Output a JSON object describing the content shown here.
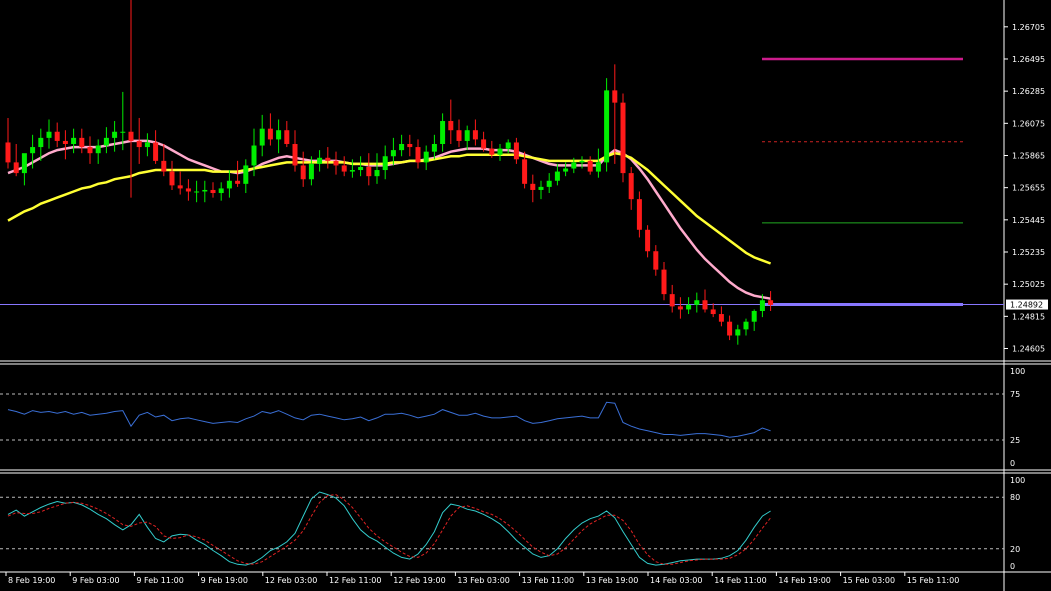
{
  "chart_data": [
    {
      "type": "candlestick",
      "panel": "price",
      "x_labels": [
        "8 Feb 19:00",
        "9 Feb 03:00",
        "9 Feb 11:00",
        "9 Feb 19:00",
        "12 Feb 03:00",
        "12 Feb 11:00",
        "12 Feb 19:00",
        "13 Feb 03:00",
        "13 Feb 11:00",
        "13 Feb 19:00",
        "14 Feb 03:00",
        "14 Feb 11:00",
        "14 Feb 19:00",
        "15 Feb 03:00",
        "15 Feb 11:00"
      ],
      "y_ticks": [
        "1.26705",
        "1.26495",
        "1.26285",
        "1.26075",
        "1.25865",
        "1.25655",
        "1.25445",
        "1.25235",
        "1.25025",
        "1.24815",
        "1.24605"
      ],
      "ylim": [
        1.2453,
        1.2688
      ],
      "current_price_label": "1.24892",
      "current_price": 1.24892,
      "levels": [
        {
          "name": "magenta-level",
          "price": 1.26495,
          "color": "#cc1c8c",
          "style": "solid"
        },
        {
          "name": "red-dashed-level",
          "price": 1.25955,
          "color": "#cc2222",
          "style": "dashed"
        },
        {
          "name": "green-level",
          "price": 1.25425,
          "color": "#22aa22",
          "style": "solid"
        },
        {
          "name": "blue-level",
          "price": 1.24892,
          "color": "#8877ff",
          "style": "solid"
        }
      ],
      "candles": {
        "open": [
          1.2595,
          1.2582,
          1.2575,
          1.2588,
          1.2592,
          1.2598,
          1.2602,
          1.2596,
          1.2594,
          1.2598,
          1.2592,
          1.2588,
          1.2593,
          1.2598,
          1.2602,
          1.2602,
          1.2596,
          1.2592,
          1.2595,
          1.2583,
          1.2576,
          1.2567,
          1.2565,
          1.2563,
          1.2563,
          1.2564,
          1.2562,
          1.2565,
          1.257,
          1.2568,
          1.258,
          1.2593,
          1.2604,
          1.2597,
          1.2603,
          1.2594,
          1.258,
          1.2571,
          1.2581,
          1.2585,
          1.2583,
          1.258,
          1.2576,
          1.2577,
          1.2579,
          1.2573,
          1.2577,
          1.2586,
          1.259,
          1.2594,
          1.2592,
          1.2582,
          1.2589,
          1.2594,
          1.2609,
          1.2603,
          1.2596,
          1.2603,
          1.2597,
          1.2591,
          1.2587,
          1.2591,
          1.2595,
          1.2584,
          1.2568,
          1.2564,
          1.2566,
          1.257,
          1.2576,
          1.2578,
          1.2582,
          1.2583,
          1.2576,
          1.2582,
          1.2629,
          1.2621,
          1.2575,
          1.2558,
          1.2538,
          1.2524,
          1.2512,
          1.2496,
          1.2488,
          1.2486,
          1.2489,
          1.2492,
          1.2486,
          1.2483,
          1.2478,
          1.2469,
          1.2473,
          1.2478,
          1.2485,
          1.2492
        ],
        "high": [
          1.2611,
          1.2594,
          1.258,
          1.26,
          1.2604,
          1.261,
          1.2608,
          1.2603,
          1.2604,
          1.2604,
          1.2599,
          1.2597,
          1.2605,
          1.2609,
          1.2628,
          1.2688,
          1.2611,
          1.2601,
          1.2603,
          1.2594,
          1.2583,
          1.2576,
          1.2571,
          1.257,
          1.257,
          1.2569,
          1.2569,
          1.2577,
          1.2583,
          1.2584,
          1.2604,
          1.2613,
          1.2614,
          1.261,
          1.2609,
          1.2603,
          1.2589,
          1.2586,
          1.259,
          1.2592,
          1.2589,
          1.2586,
          1.2584,
          1.2586,
          1.2588,
          1.2588,
          1.2593,
          1.2598,
          1.26,
          1.26,
          1.2597,
          1.2593,
          1.26,
          1.2614,
          1.2623,
          1.261,
          1.2606,
          1.261,
          1.2602,
          1.2596,
          1.2594,
          1.2597,
          1.2598,
          1.2589,
          1.2574,
          1.257,
          1.2575,
          1.2581,
          1.2582,
          1.2585,
          1.2586,
          1.2586,
          1.2591,
          1.2637,
          1.2646,
          1.2627,
          1.2579,
          1.2563,
          1.2541,
          1.2528,
          1.2517,
          1.2502,
          1.2494,
          1.2494,
          1.2497,
          1.2499,
          1.249,
          1.2488,
          1.2482,
          1.2476,
          1.248,
          1.2486,
          1.2496,
          1.2498
        ],
        "low": [
          1.2578,
          1.2573,
          1.2567,
          1.2578,
          1.2583,
          1.2591,
          1.2592,
          1.2584,
          1.2588,
          1.2588,
          1.2581,
          1.2581,
          1.2588,
          1.2589,
          1.259,
          1.2559,
          1.2581,
          1.2586,
          1.2581,
          1.2573,
          1.2564,
          1.2561,
          1.2557,
          1.2556,
          1.2556,
          1.2559,
          1.2557,
          1.2559,
          1.2566,
          1.2562,
          1.2573,
          1.2586,
          1.2593,
          1.2588,
          1.2592,
          1.2576,
          1.2566,
          1.2567,
          1.2576,
          1.2578,
          1.2574,
          1.2573,
          1.2572,
          1.2573,
          1.2567,
          1.2568,
          1.2571,
          1.258,
          1.2586,
          1.2586,
          1.2578,
          1.2577,
          1.2584,
          1.2589,
          1.2594,
          1.2592,
          1.259,
          1.2593,
          1.2589,
          1.2585,
          1.2583,
          1.2588,
          1.2581,
          1.2565,
          1.2556,
          1.2558,
          1.2562,
          1.2567,
          1.2573,
          1.2575,
          1.2578,
          1.2574,
          1.2572,
          1.2576,
          1.2581,
          1.2569,
          1.2551,
          1.2533,
          1.252,
          1.2508,
          1.2492,
          1.2484,
          1.248,
          1.2483,
          1.2484,
          1.2484,
          1.2481,
          1.2475,
          1.2466,
          1.2463,
          1.2469,
          1.2472,
          1.2481,
          1.2485
        ],
        "close": [
          1.2582,
          1.2575,
          1.2588,
          1.2592,
          1.2598,
          1.2602,
          1.2596,
          1.2594,
          1.2598,
          1.2592,
          1.2588,
          1.2593,
          1.2598,
          1.2602,
          1.2602,
          1.2596,
          1.2592,
          1.2595,
          1.2583,
          1.2576,
          1.2567,
          1.2565,
          1.2563,
          1.2563,
          1.2564,
          1.2562,
          1.2565,
          1.257,
          1.2568,
          1.258,
          1.2593,
          1.2604,
          1.2597,
          1.2603,
          1.2594,
          1.258,
          1.2571,
          1.2581,
          1.2585,
          1.2583,
          1.258,
          1.2576,
          1.2577,
          1.2579,
          1.2573,
          1.2577,
          1.2586,
          1.259,
          1.2594,
          1.2592,
          1.2582,
          1.2589,
          1.2594,
          1.2609,
          1.2603,
          1.2596,
          1.2603,
          1.2597,
          1.2591,
          1.2587,
          1.2591,
          1.2595,
          1.2584,
          1.2568,
          1.2564,
          1.2566,
          1.257,
          1.2576,
          1.2578,
          1.2582,
          1.2583,
          1.2576,
          1.2582,
          1.2629,
          1.2621,
          1.2575,
          1.2558,
          1.2538,
          1.2524,
          1.2512,
          1.2496,
          1.2488,
          1.2486,
          1.2489,
          1.2492,
          1.2486,
          1.2483,
          1.2478,
          1.2469,
          1.2473,
          1.2478,
          1.2485,
          1.2492,
          1.2489
        ]
      },
      "moving_averages": [
        {
          "color": "#ffaacc",
          "values": [
            1.2575,
            1.2577,
            1.2579,
            1.2582,
            1.2585,
            1.2588,
            1.259,
            1.2591,
            1.2592,
            1.2592,
            1.2592,
            1.2592,
            1.2593,
            1.2594,
            1.2595,
            1.2596,
            1.2596,
            1.2596,
            1.2595,
            1.2593,
            1.259,
            1.2587,
            1.2584,
            1.2582,
            1.258,
            1.2578,
            1.2576,
            1.2576,
            1.2575,
            1.2576,
            1.2578,
            1.2581,
            1.2583,
            1.2585,
            1.2586,
            1.2585,
            1.2584,
            1.2583,
            1.2583,
            1.2583,
            1.2583,
            1.2582,
            1.2581,
            1.2581,
            1.258,
            1.258,
            1.258,
            1.2581,
            1.2582,
            1.2583,
            1.2583,
            1.2584,
            1.2585,
            1.2587,
            1.2589,
            1.259,
            1.2591,
            1.2591,
            1.2591,
            1.259,
            1.259,
            1.259,
            1.2589,
            1.2587,
            1.2585,
            1.2583,
            1.2581,
            1.258,
            1.258,
            1.258,
            1.258,
            1.258,
            1.258,
            1.2586,
            1.259,
            1.2588,
            1.2584,
            1.2578,
            1.2571,
            1.2563,
            1.2555,
            1.2547,
            1.2539,
            1.2532,
            1.2525,
            1.2519,
            1.2514,
            1.2509,
            1.2504,
            1.25,
            1.2497,
            1.2495,
            1.2494,
            1.2493
          ]
        },
        {
          "color": "#ffff33",
          "values": [
            1.2544,
            1.2547,
            1.255,
            1.2552,
            1.2555,
            1.2557,
            1.2559,
            1.2561,
            1.2563,
            1.2565,
            1.2566,
            1.2568,
            1.2569,
            1.2571,
            1.2572,
            1.2573,
            1.2575,
            1.2576,
            1.2577,
            1.2577,
            1.2577,
            1.2577,
            1.2577,
            1.2577,
            1.2577,
            1.2576,
            1.2576,
            1.2576,
            1.2576,
            1.2577,
            1.2578,
            1.2579,
            1.258,
            1.2581,
            1.2582,
            1.2582,
            1.2582,
            1.2582,
            1.2582,
            1.2582,
            1.2582,
            1.2582,
            1.2581,
            1.2581,
            1.2581,
            1.2581,
            1.2581,
            1.2582,
            1.2582,
            1.2583,
            1.2583,
            1.2583,
            1.2584,
            1.2585,
            1.2586,
            1.2586,
            1.2587,
            1.2587,
            1.2587,
            1.2587,
            1.2587,
            1.2587,
            1.2587,
            1.2586,
            1.2585,
            1.2584,
            1.2583,
            1.2583,
            1.2583,
            1.2583,
            1.2583,
            1.2583,
            1.2583,
            1.2586,
            1.2588,
            1.2587,
            1.2585,
            1.2581,
            1.2577,
            1.2572,
            1.2567,
            1.2562,
            1.2557,
            1.2552,
            1.2547,
            1.2543,
            1.2539,
            1.2535,
            1.2531,
            1.2527,
            1.2523,
            1.252,
            1.2518,
            1.2516
          ]
        }
      ]
    },
    {
      "type": "line",
      "panel": "oscillator-1",
      "y_ticks": [
        "100",
        "75",
        "25",
        "0"
      ],
      "ylim": [
        0,
        100
      ],
      "levels": [
        75,
        25
      ],
      "series": [
        {
          "color": "#3a6fd6",
          "values": [
            58,
            56,
            53,
            57,
            55,
            56,
            54,
            56,
            53,
            55,
            52,
            53,
            54,
            56,
            57,
            40,
            52,
            55,
            50,
            52,
            46,
            48,
            49,
            47,
            45,
            43,
            44,
            45,
            44,
            48,
            51,
            56,
            54,
            57,
            53,
            49,
            47,
            52,
            53,
            51,
            49,
            47,
            48,
            50,
            46,
            49,
            53,
            53,
            54,
            52,
            49,
            51,
            53,
            58,
            55,
            52,
            52,
            54,
            51,
            49,
            49,
            50,
            51,
            46,
            43,
            44,
            46,
            48,
            49,
            50,
            51,
            49,
            49,
            66,
            65,
            44,
            40,
            37,
            35,
            33,
            31,
            31,
            30,
            31,
            32,
            32,
            31,
            30,
            28,
            29,
            31,
            33,
            38,
            35
          ]
        }
      ]
    },
    {
      "type": "line",
      "panel": "oscillator-2",
      "y_ticks": [
        "100",
        "80",
        "20",
        "0"
      ],
      "ylim": [
        0,
        100
      ],
      "levels": [
        80,
        20
      ],
      "series": [
        {
          "color": "#33cccc",
          "values": [
            60,
            65,
            58,
            63,
            68,
            72,
            75,
            73,
            74,
            71,
            66,
            60,
            55,
            48,
            42,
            48,
            60,
            45,
            32,
            28,
            35,
            37,
            36,
            30,
            25,
            18,
            12,
            5,
            2,
            1,
            4,
            10,
            18,
            22,
            28,
            38,
            58,
            78,
            86,
            83,
            79,
            70,
            55,
            42,
            34,
            29,
            22,
            15,
            10,
            8,
            14,
            25,
            40,
            62,
            72,
            70,
            66,
            64,
            60,
            55,
            49,
            40,
            30,
            22,
            14,
            10,
            12,
            20,
            32,
            42,
            50,
            55,
            58,
            64,
            56,
            40,
            25,
            10,
            3,
            1,
            2,
            4,
            6,
            7,
            8,
            8,
            8,
            9,
            12,
            18,
            30,
            45,
            58,
            64
          ]
        },
        {
          "color": "#dd2222",
          "dash": true,
          "values": [
            58,
            62,
            61,
            61,
            63,
            67,
            70,
            73,
            74,
            73,
            70,
            66,
            61,
            55,
            48,
            46,
            50,
            51,
            46,
            35,
            32,
            33,
            36,
            34,
            30,
            24,
            18,
            12,
            6,
            3,
            2,
            5,
            11,
            17,
            23,
            30,
            41,
            58,
            74,
            82,
            83,
            77,
            68,
            56,
            44,
            35,
            28,
            22,
            16,
            11,
            10,
            15,
            26,
            42,
            58,
            68,
            70,
            67,
            63,
            60,
            55,
            48,
            40,
            31,
            22,
            16,
            12,
            14,
            21,
            31,
            41,
            49,
            54,
            59,
            59,
            53,
            41,
            25,
            13,
            5,
            2,
            2,
            4,
            6,
            7,
            8,
            8,
            8,
            9,
            13,
            20,
            31,
            44,
            56
          ]
        }
      ]
    }
  ]
}
